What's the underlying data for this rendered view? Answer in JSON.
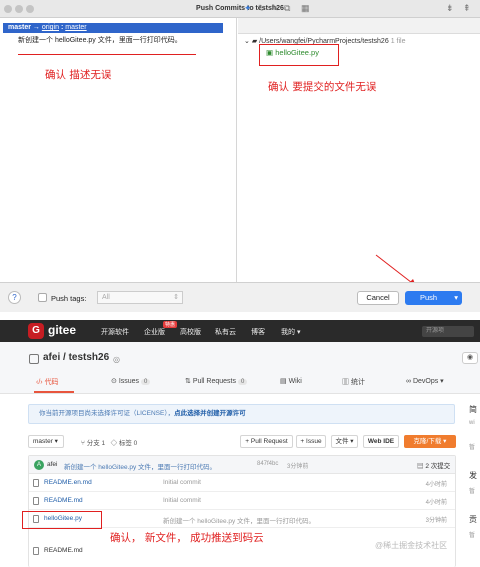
{
  "dialog": {
    "title": "Push Commits to testsh26",
    "branch_line": {
      "local": "master",
      "arrow": "→",
      "remote": "origin",
      "sep": ":",
      "target": "master"
    },
    "commit_message": "新创建一个 helloGitee.py 文件，里面一行打印代码。",
    "note_left": "确认 描述无误",
    "path": "/Users/wangfei/PycharmProjects/testsh26",
    "file_count": "1 file",
    "file": "helloGitee.py",
    "note_right": "确认 要提交的文件无误",
    "help_glyph": "?",
    "push_tags_label": "Push tags:",
    "push_tags_value": "All",
    "cancel_label": "Cancel",
    "push_label": "Push",
    "accent_color": "#2d7bf0",
    "annotation_color": "#e02020"
  },
  "gitee": {
    "logo_text": "gitee",
    "nav": [
      "开源软件",
      "企业版",
      "高校版",
      "私有云",
      "博客",
      "我的"
    ],
    "hot_badge": "特惠",
    "search_placeholder": "开源项",
    "repo": "afei / testsh26",
    "tabs": {
      "code": "代码",
      "issues": "Issues",
      "issues_count": "0",
      "pulls": "Pull Requests",
      "pulls_count": "0",
      "wiki": "Wiki",
      "stats": "统计",
      "devops": "DevOps"
    },
    "license_text": "你当前开源项目尚未选择许可证（LICENSE），",
    "license_link": "点此选择并创建开源许可",
    "branch": "master",
    "branches_label": "分支 1",
    "tags_label": "标签 0",
    "pr_button": "+ Pull Request",
    "issue_button": "+ Issue",
    "file_button": "文件",
    "webide_button": "Web IDE",
    "clone_button": "克隆/下载",
    "last_commit": {
      "avatar": "A",
      "user": "afei",
      "message": "新创建一个 helloGitee.py 文件，里面一行打印代码。",
      "hash": "847f4bc",
      "time": "3分钟前",
      "count": "2 次提交"
    },
    "files": [
      {
        "name": "README.en.md",
        "message": "Initial commit",
        "time": "4小时前"
      },
      {
        "name": "README.md",
        "message": "Initial commit",
        "time": "4小时前"
      },
      {
        "name": "helloGitee.py",
        "message": "新创建一个 helloGitee.py 文件，里面一行打印代码。",
        "time": "3分钟前"
      },
      {
        "name": "README.md",
        "message": "",
        "time": ""
      }
    ],
    "right_sidebar": [
      "简",
      "发",
      "贡"
    ],
    "note": "确认，  新文件，  成功推送到码云",
    "watermark": "@稀土掘金技术社区",
    "brand_color": "#c71d23",
    "clone_color": "#f07c2e"
  }
}
